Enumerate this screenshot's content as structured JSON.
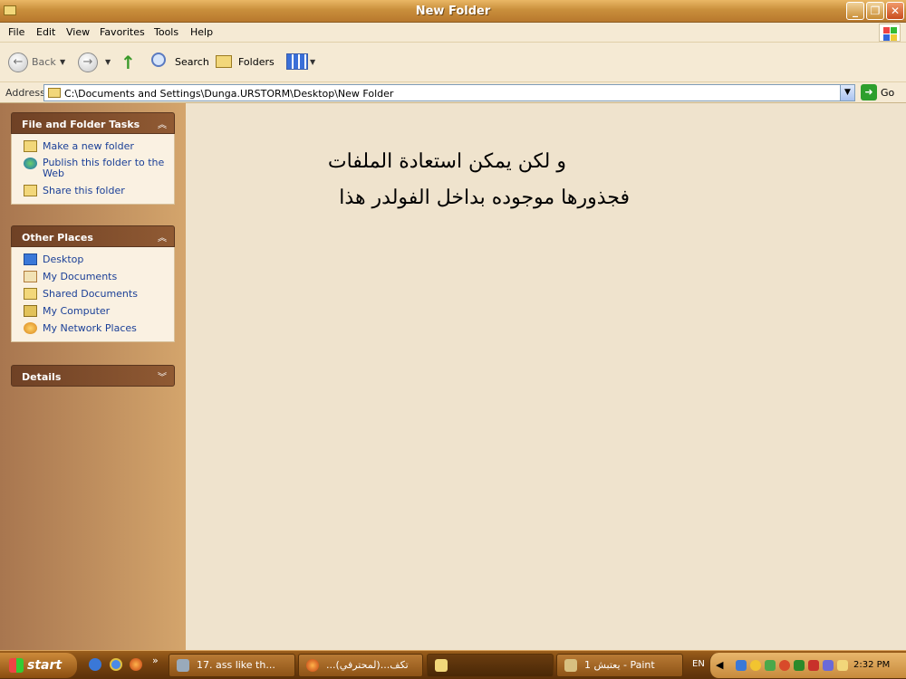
{
  "window": {
    "title": "New Folder"
  },
  "menu": [
    "File",
    "Edit",
    "View",
    "Favorites",
    "Tools",
    "Help"
  ],
  "toolbar": {
    "back": "Back",
    "search": "Search",
    "folders": "Folders"
  },
  "address": {
    "label": "Address",
    "value": "C:\\Documents and Settings\\Dunga.URSTORM\\Desktop\\New Folder",
    "go": "Go"
  },
  "tasks": {
    "title": "File and Folder Tasks",
    "items": [
      "Make a new folder",
      "Publish this folder to the Web",
      "Share this folder"
    ]
  },
  "places": {
    "title": "Other Places",
    "items": [
      "Desktop",
      "My Documents",
      "Shared Documents",
      "My Computer",
      "My Network Places"
    ]
  },
  "details": {
    "title": "Details"
  },
  "content": {
    "line1": "و لكن يمكن استعادة الملفات",
    "line2": "فجذورها موجوده بداخل الفولدر هذا"
  },
  "taskbar": {
    "start": "start",
    "tasks": [
      "17. ass like th...",
      "...تكف...(لمحترفي)",
      "",
      "يعتبش 1 - Paint"
    ],
    "lang": "EN",
    "clock": "2:32 PM"
  },
  "colors": {
    "accent": "#c98f3c",
    "panel": "#6f4125",
    "link": "#1a3f97"
  }
}
